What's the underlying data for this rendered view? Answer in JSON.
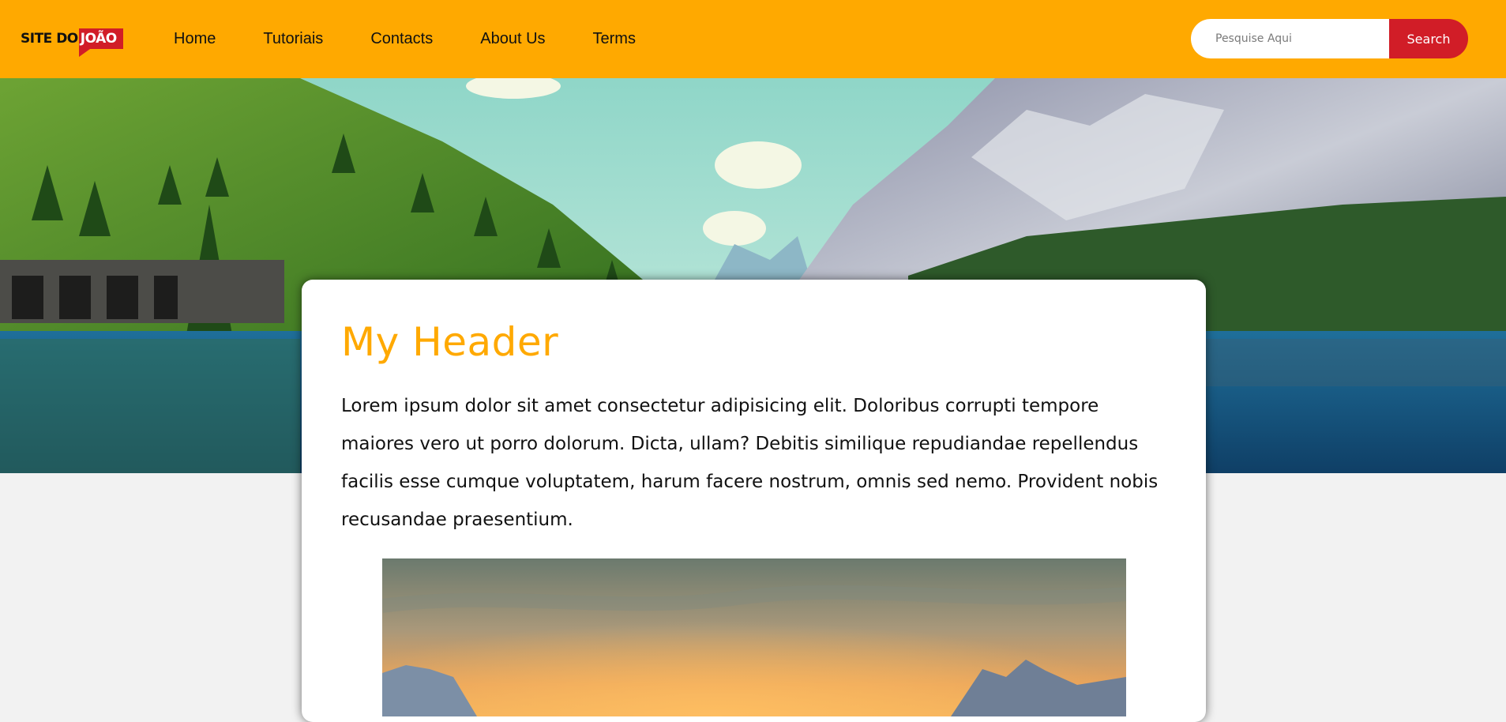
{
  "header": {
    "logo": {
      "part1": "SITE DO",
      "part2": "JOÃO"
    },
    "nav": [
      {
        "label": "Home"
      },
      {
        "label": "Tutoriais"
      },
      {
        "label": "Contacts"
      },
      {
        "label": "About Us"
      },
      {
        "label": "Terms"
      }
    ],
    "search": {
      "placeholder": "Pesquise Aqui",
      "value": "",
      "button_label": "Search"
    }
  },
  "card": {
    "title": "My Header",
    "text": "Lorem ipsum dolor sit amet consectetur adipisicing elit. Doloribus corrupti tempore maiores vero ut porro dolorum. Dicta, ullam? Debitis similique repudiandae repellendus facilis esse cumque voluptatem, harum facere nostrum, omnis sed nemo. Provident nobis recusandae praesentium."
  },
  "colors": {
    "topbar": "#ffa900",
    "accent_red": "#d11d27",
    "title": "#ffa900",
    "page_background": "#f2f2f2"
  }
}
